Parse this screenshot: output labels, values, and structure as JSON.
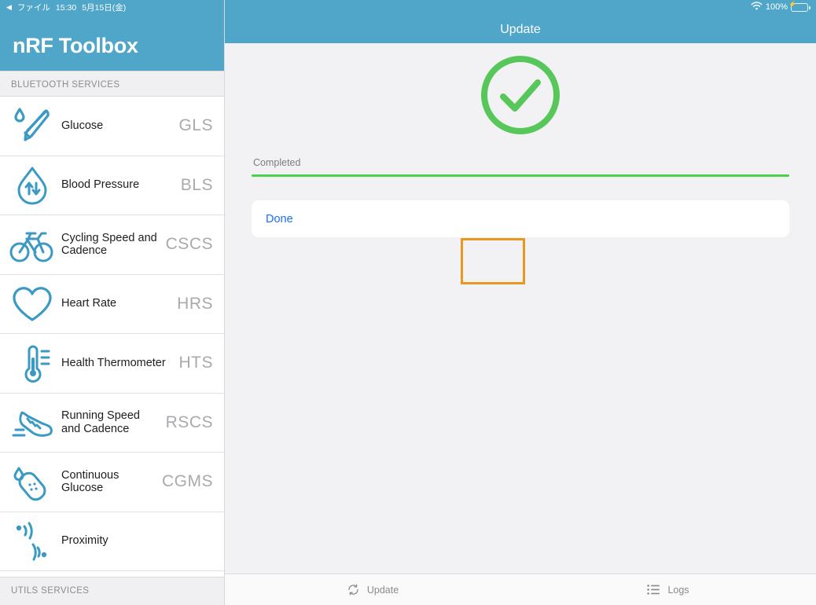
{
  "status_bar": {
    "back_arrow": "◀",
    "back_app": "ファイル",
    "time": "15:30",
    "date": "5月15日(金)",
    "wifi_icon": "wifi-icon",
    "battery_percent": "100%",
    "battery_icon": "battery-charging-icon"
  },
  "sidebar": {
    "app_title": "nRF Toolbox",
    "section_bluetooth": "BLUETOOTH SERVICES",
    "section_utils": "UTILS SERVICES",
    "items": [
      {
        "label": "Glucose",
        "abbr": "GLS",
        "icon": "glucose-meter-icon"
      },
      {
        "label": "Blood Pressure",
        "abbr": "BLS",
        "icon": "blood-drop-arrows-icon"
      },
      {
        "label": "Cycling Speed and Cadence",
        "abbr": "CSCS",
        "icon": "bicycle-icon"
      },
      {
        "label": "Heart Rate",
        "abbr": "HRS",
        "icon": "heart-icon"
      },
      {
        "label": "Health Thermometer",
        "abbr": "HTS",
        "icon": "thermometer-icon"
      },
      {
        "label": "Running Speed and Cadence",
        "abbr": "RSCS",
        "icon": "running-shoe-icon"
      },
      {
        "label": "Continuous Glucose",
        "abbr": "CGMS",
        "icon": "sensor-patch-icon"
      },
      {
        "label": "Proximity",
        "abbr": "",
        "icon": "proximity-waves-icon"
      }
    ]
  },
  "navbar": {
    "title": "Update"
  },
  "main": {
    "success_icon": "check-circle-icon",
    "status_text": "Completed",
    "progress_percent": 100,
    "done_label": "Done",
    "highlight_target": "done-button"
  },
  "tabbar": {
    "tabs": [
      {
        "label": "Update",
        "icon": "sync-arrows-icon"
      },
      {
        "label": "Logs",
        "icon": "list-icon"
      }
    ]
  },
  "colors": {
    "brand_blue": "#4fa6c9",
    "icon_blue": "#3a9ac4",
    "success_green": "#4cd14c",
    "link_blue": "#1a6ef2",
    "highlight_orange": "#e8981f"
  }
}
